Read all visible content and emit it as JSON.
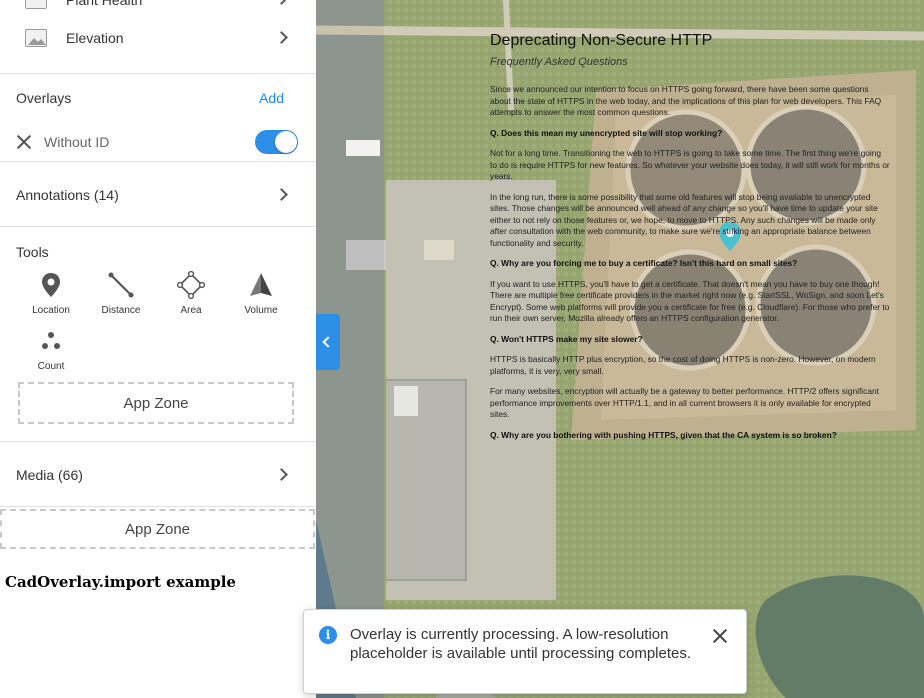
{
  "sidebar": {
    "layers": [
      {
        "label": "Plant Health",
        "icon": "plant-health-layer-icon"
      },
      {
        "label": "Elevation",
        "icon": "elevation-layer-icon"
      }
    ],
    "overlays": {
      "title": "Overlays",
      "add_label": "Add",
      "item": {
        "label": "Without ID",
        "enabled": true
      }
    },
    "annotations_label": "Annotations (14)",
    "tools": {
      "title": "Tools",
      "items": [
        {
          "label": "Location",
          "icon": "location-pin-icon"
        },
        {
          "label": "Distance",
          "icon": "distance-ruler-icon"
        },
        {
          "label": "Area",
          "icon": "area-polygon-icon"
        },
        {
          "label": "Volume",
          "icon": "volume-pyramid-icon"
        },
        {
          "label": "Count",
          "icon": "count-dots-icon"
        }
      ]
    },
    "app_zone_label": "App Zone",
    "media_label": "Media (66)",
    "app_zone_2_label": "App Zone",
    "cad_example_title": "CadOverlay.import example"
  },
  "document": {
    "title": "Deprecating Non-Secure HTTP",
    "subtitle": "Frequently Asked Questions",
    "paragraphs": [
      {
        "type": "p",
        "text": "Since we announced our intention to focus on HTTPS going forward, there have been some questions about the state of HTTPS in the web today, and the implications of this plan for web developers. This FAQ attempts to answer the most common questions."
      },
      {
        "type": "q",
        "text": "Q. Does this mean my unencrypted site will stop working?"
      },
      {
        "type": "p",
        "text": "Not for a long time. Transitioning the web to HTTPS is going to take some time. The first thing we're going to do is require HTTPS for new features. So whatever your website does today, it will still work for months or years."
      },
      {
        "type": "p",
        "text": "In the long run, there is some possibility that some old features will stop being available to unencrypted sites. Those changes will be announced well ahead of any change so you'll have time to update your site either to not rely on those features or, we hope, to move to HTTPS. Any such changes will be made only after consultation with the web community, to make sure we're striking an appropriate balance between functionality and security."
      },
      {
        "type": "q",
        "text": "Q. Why are you forcing me to buy a certificate? Isn't this hard on small sites?"
      },
      {
        "type": "p",
        "text": "If you want to use HTTPS, you'll have to get a certificate. That doesn't mean you have to buy one though! There are multiple free certificate providers in the market right now (e.g. StartSSL, WoSign, and soon Let's Encrypt). Some web platforms will provide you a certificate for free (e.g. Cloudflare). For those who prefer to run their own server, Mozilla already offers an HTTPS configuration generator."
      },
      {
        "type": "q",
        "text": "Q. Won't HTTPS make my site slower?"
      },
      {
        "type": "p",
        "text": "HTTPS is basically HTTP plus encryption, so the cost of doing HTTPS is non-zero. However, on modern platforms, it is very, very small."
      },
      {
        "type": "p",
        "text": "For many websites, encryption will actually be a gateway to better performance. HTTP/2 offers significant performance improvements over HTTP/1.1, and in all current browsers it is only available for encrypted sites."
      },
      {
        "type": "q",
        "text": "Q. Why are you bothering with pushing HTTPS, given that the CA system is so broken?"
      }
    ]
  },
  "toast": {
    "message": "Overlay is currently processing. A low-resolution placeholder is available until processing completes."
  },
  "colors": {
    "accent": "#2d8ee6",
    "map_pin": "#1fb5c9"
  }
}
